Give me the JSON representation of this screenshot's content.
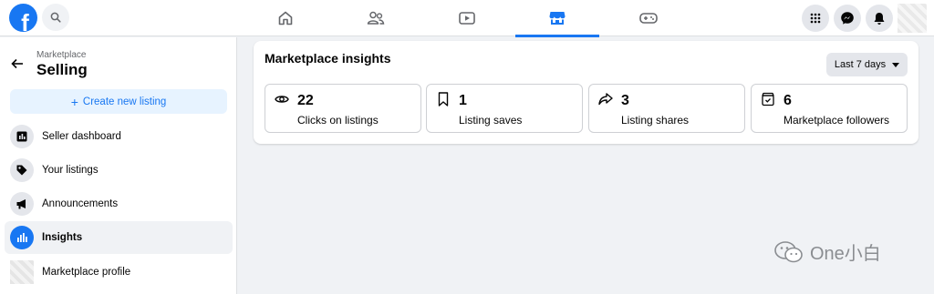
{
  "topbar": {
    "logo_letter": "f",
    "nav_tabs": [
      {
        "name": "home-icon"
      },
      {
        "name": "friends-icon"
      },
      {
        "name": "watch-icon"
      },
      {
        "name": "marketplace-icon",
        "active": true
      },
      {
        "name": "gaming-icon"
      }
    ],
    "right_buttons": [
      "menu-grid-icon",
      "messenger-icon",
      "notifications-icon"
    ],
    "accent_color": "#1877f2"
  },
  "sidebar": {
    "breadcrumb": "Marketplace",
    "title": "Selling",
    "create_button": "Create new listing",
    "items": [
      {
        "label": "Seller dashboard",
        "icon": "dashboard-icon"
      },
      {
        "label": "Your listings",
        "icon": "tag-icon"
      },
      {
        "label": "Announcements",
        "icon": "megaphone-icon"
      },
      {
        "label": "Insights",
        "icon": "bar-chart-icon",
        "active": true
      },
      {
        "label": "Marketplace profile",
        "icon": "profile-avatar"
      }
    ]
  },
  "insights": {
    "title": "Marketplace insights",
    "range_select": "Last 7 days",
    "stats": [
      {
        "value": "22",
        "label": "Clicks on listings",
        "icon": "eye-icon"
      },
      {
        "value": "1",
        "label": "Listing saves",
        "icon": "bookmark-icon"
      },
      {
        "value": "3",
        "label": "Listing shares",
        "icon": "share-icon"
      },
      {
        "value": "6",
        "label": "Marketplace followers",
        "icon": "shop-bag-icon"
      }
    ]
  },
  "watermark": {
    "text": "One小白"
  }
}
